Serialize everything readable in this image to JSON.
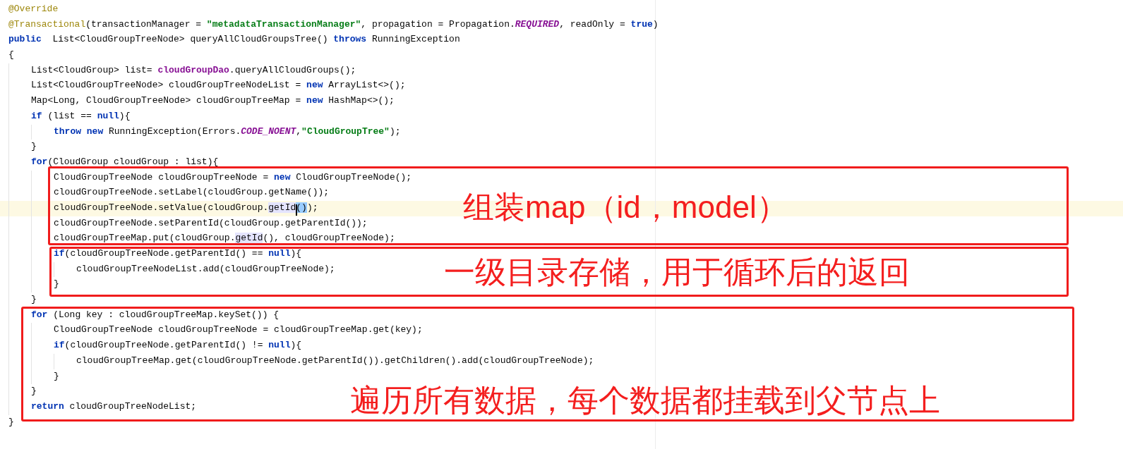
{
  "code": [
    {
      "current": false,
      "tokens": [
        {
          "kind": "annotation",
          "text": "@Override"
        }
      ]
    },
    {
      "current": false,
      "tokens": [
        {
          "kind": "annotation",
          "text": "@Transactional"
        },
        {
          "kind": "plain",
          "text": "(transactionManager = "
        },
        {
          "kind": "string",
          "text": "\"metadataTransactionManager\""
        },
        {
          "kind": "plain",
          "text": ", propagation = Propagation."
        },
        {
          "kind": "constant",
          "text": "REQUIRED"
        },
        {
          "kind": "plain",
          "text": ", readOnly = "
        },
        {
          "kind": "keyword",
          "text": "true"
        },
        {
          "kind": "plain",
          "text": ")"
        }
      ]
    },
    {
      "current": false,
      "tokens": [
        {
          "kind": "keyword",
          "text": "public"
        },
        {
          "kind": "plain",
          "text": "  List<CloudGroupTreeNode> queryAllCloudGroupsTree() "
        },
        {
          "kind": "keyword",
          "text": "throws"
        },
        {
          "kind": "plain",
          "text": " RunningException"
        }
      ]
    },
    {
      "current": false,
      "tokens": [
        {
          "kind": "plain",
          "text": "{"
        }
      ],
      "children": [
        {
          "current": false,
          "tokens": [
            {
              "kind": "plain",
              "text": "List<CloudGroup> list= "
            },
            {
              "kind": "field",
              "text": "cloudGroupDao"
            },
            {
              "kind": "plain",
              "text": ".queryAllCloudGroups();"
            }
          ]
        },
        {
          "current": false,
          "tokens": [
            {
              "kind": "plain",
              "text": "List<CloudGroupTreeNode> cloudGroupTreeNodeList = "
            },
            {
              "kind": "keyword",
              "text": "new"
            },
            {
              "kind": "plain",
              "text": " ArrayList<>();"
            }
          ]
        },
        {
          "current": false,
          "tokens": [
            {
              "kind": "plain",
              "text": "Map<Long, CloudGroupTreeNode> cloudGroupTreeMap = "
            },
            {
              "kind": "keyword",
              "text": "new"
            },
            {
              "kind": "plain",
              "text": " HashMap<>();"
            }
          ]
        },
        {
          "current": false,
          "tokens": [
            {
              "kind": "keyword",
              "text": "if"
            },
            {
              "kind": "plain",
              "text": " (list == "
            },
            {
              "kind": "keyword",
              "text": "null"
            },
            {
              "kind": "plain",
              "text": "){"
            }
          ],
          "children": [
            {
              "current": false,
              "tokens": [
                {
                  "kind": "keyword",
                  "text": "throw new"
                },
                {
                  "kind": "plain",
                  "text": " RunningException(Errors."
                },
                {
                  "kind": "constant",
                  "text": "CODE_NOENT"
                },
                {
                  "kind": "plain",
                  "text": ","
                },
                {
                  "kind": "string",
                  "text": "\"CloudGroupTree\""
                },
                {
                  "kind": "plain",
                  "text": ");"
                }
              ]
            }
          ]
        },
        {
          "current": false,
          "tokens": [
            {
              "kind": "plain",
              "text": "}"
            }
          ]
        },
        {
          "current": false,
          "tokens": [
            {
              "kind": "keyword",
              "text": "for"
            },
            {
              "kind": "plain",
              "text": "(CloudGroup cloudGroup : list){"
            }
          ],
          "children": [
            {
              "current": false,
              "tokens": [
                {
                  "kind": "plain",
                  "text": "CloudGroupTreeNode cloudGroupTreeNode = "
                },
                {
                  "kind": "keyword",
                  "text": "new"
                },
                {
                  "kind": "plain",
                  "text": " CloudGroupTreeNode();"
                }
              ]
            },
            {
              "current": false,
              "tokens": [
                {
                  "kind": "plain",
                  "text": "cloudGroupTreeNode.setLabel(cloudGroup.getName());"
                }
              ]
            },
            {
              "current": true,
              "tokens": [
                {
                  "kind": "plain",
                  "text": "cloudGroupTreeNode.setValue(cloudGroup."
                },
                {
                  "kind": "usage",
                  "text": "getId"
                },
                {
                  "kind": "match",
                  "text": "()"
                },
                {
                  "kind": "plain",
                  "text": ");"
                }
              ]
            },
            {
              "current": false,
              "tokens": [
                {
                  "kind": "plain",
                  "text": "cloudGroupTreeNode.setParentId(cloudGroup.getParentId());"
                }
              ]
            },
            {
              "current": false,
              "tokens": [
                {
                  "kind": "plain",
                  "text": "cloudGroupTreeMap.put(cloudGroup."
                },
                {
                  "kind": "usage",
                  "text": "getId"
                },
                {
                  "kind": "plain",
                  "text": "(), cloudGroupTreeNode);"
                }
              ]
            },
            {
              "current": false,
              "tokens": [
                {
                  "kind": "keyword",
                  "text": "if"
                },
                {
                  "kind": "plain",
                  "text": "(cloudGroupTreeNode.getParentId() == "
                },
                {
                  "kind": "keyword",
                  "text": "null"
                },
                {
                  "kind": "plain",
                  "text": "){"
                }
              ],
              "children": [
                {
                  "current": false,
                  "tokens": [
                    {
                      "kind": "plain",
                      "text": "cloudGroupTreeNodeList.add(cloudGroupTreeNode);"
                    }
                  ]
                }
              ]
            },
            {
              "current": false,
              "tokens": [
                {
                  "kind": "plain",
                  "text": "}"
                }
              ]
            }
          ]
        },
        {
          "current": false,
          "tokens": [
            {
              "kind": "plain",
              "text": "}"
            }
          ]
        },
        {
          "current": false,
          "tokens": [
            {
              "kind": "keyword",
              "text": "for"
            },
            {
              "kind": "plain",
              "text": " (Long key : cloudGroupTreeMap.keySet()) {"
            }
          ],
          "children": [
            {
              "current": false,
              "tokens": [
                {
                  "kind": "plain",
                  "text": "CloudGroupTreeNode cloudGroupTreeNode = cloudGroupTreeMap.get(key);"
                }
              ]
            },
            {
              "current": false,
              "tokens": [
                {
                  "kind": "keyword",
                  "text": "if"
                },
                {
                  "kind": "plain",
                  "text": "(cloudGroupTreeNode.getParentId() != "
                },
                {
                  "kind": "keyword",
                  "text": "null"
                },
                {
                  "kind": "plain",
                  "text": "){"
                }
              ],
              "children": [
                {
                  "current": false,
                  "tokens": [
                    {
                      "kind": "plain",
                      "text": "cloudGroupTreeMap.get(cloudGroupTreeNode.getParentId()).getChildren().add(cloudGroupTreeNode);"
                    }
                  ]
                }
              ]
            },
            {
              "current": false,
              "tokens": [
                {
                  "kind": "plain",
                  "text": "}"
                }
              ]
            }
          ]
        },
        {
          "current": false,
          "tokens": [
            {
              "kind": "plain",
              "text": "}"
            }
          ]
        },
        {
          "current": false,
          "tokens": [
            {
              "kind": "keyword",
              "text": "return"
            },
            {
              "kind": "plain",
              "text": " cloudGroupTreeNodeList;"
            }
          ]
        }
      ]
    },
    {
      "current": false,
      "tokens": [
        {
          "kind": "plain",
          "text": "}"
        }
      ]
    }
  ],
  "annotations": [
    {
      "text": "组装map（id，model）"
    },
    {
      "text": "一级目录存储，用于循环后的返回"
    },
    {
      "text": "遍历所有数据，每个数据都挂载到父节点上"
    }
  ]
}
